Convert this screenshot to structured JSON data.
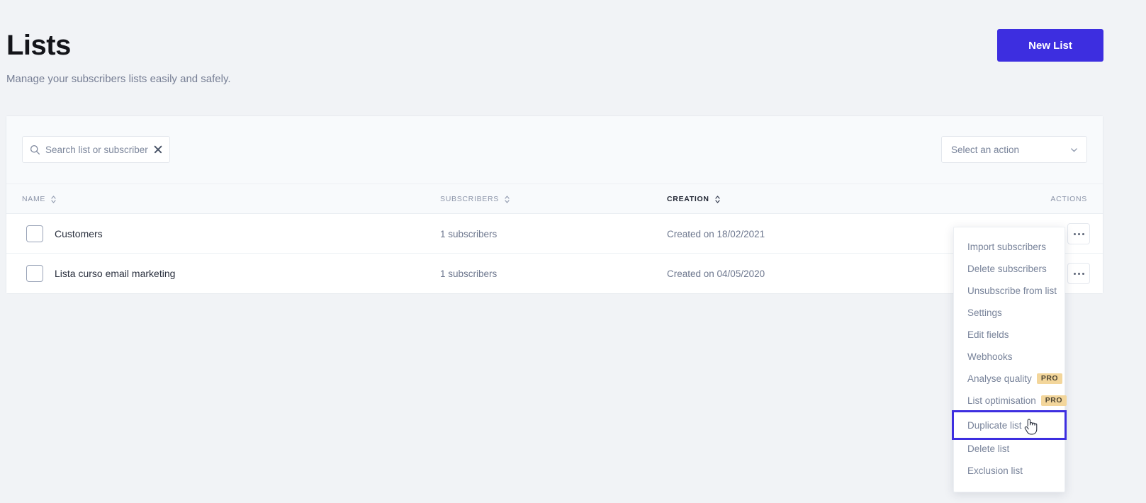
{
  "header": {
    "title": "Lists",
    "subtitle": "Manage your subscribers lists easily and safely.",
    "new_list_label": "New List"
  },
  "toolbar": {
    "search_placeholder": "Search list or subscriber",
    "search_value": "",
    "clear_icon": "close-icon",
    "search_icon": "search-icon",
    "action_select_label": "Select an action",
    "chevron_icon": "chevron-down-icon"
  },
  "table": {
    "columns": [
      {
        "key": "name",
        "label": "Name",
        "sortable": true,
        "active": false
      },
      {
        "key": "subscribers",
        "label": "Subscribers",
        "sortable": true,
        "active": false
      },
      {
        "key": "creation",
        "label": "Creation",
        "sortable": true,
        "active": true
      },
      {
        "key": "actions",
        "label": "Actions",
        "sortable": false,
        "active": false
      }
    ],
    "rows": [
      {
        "name": "Customers",
        "subscribers": "1 subscribers",
        "created": "Created on 18/02/2021",
        "checked": false
      },
      {
        "name": "Lista curso email marketing",
        "subscribers": "1 subscribers",
        "created": "Created on 04/05/2020",
        "checked": false
      }
    ]
  },
  "menu": {
    "items": [
      {
        "label": "Import subscribers",
        "pro": "",
        "highlighted": false
      },
      {
        "label": "Delete subscribers",
        "pro": "",
        "highlighted": false
      },
      {
        "label": "Unsubscribe from list",
        "pro": "",
        "highlighted": false
      },
      {
        "label": "Settings",
        "pro": "",
        "highlighted": false
      },
      {
        "label": "Edit fields",
        "pro": "",
        "highlighted": false
      },
      {
        "label": "Webhooks",
        "pro": "",
        "highlighted": false
      },
      {
        "label": "Analyse quality",
        "pro": "PRO",
        "highlighted": false
      },
      {
        "label": "List optimisation",
        "pro": "PRO",
        "highlighted": false
      },
      {
        "label": "Duplicate list",
        "pro": "",
        "highlighted": true
      },
      {
        "label": "Delete list",
        "pro": "",
        "highlighted": false
      },
      {
        "label": "Exclusion list",
        "pro": "",
        "highlighted": false
      }
    ]
  },
  "colors": {
    "accent": "#3d2ee0",
    "page_bg": "#f1f3f6",
    "pro_badge_bg": "#f3d69b",
    "muted_text": "#78839a"
  }
}
